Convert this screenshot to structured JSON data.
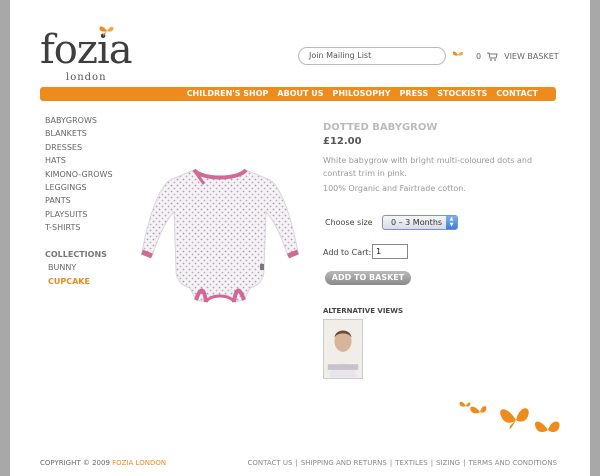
{
  "brand": {
    "name": "fozia",
    "sub": "london"
  },
  "header": {
    "mailing_label": "Join Mailing List",
    "basket_count": "0",
    "basket_label": "VIEW BASKET"
  },
  "nav": [
    "CHILDREN'S SHOP",
    "ABOUT US",
    "PHILOSOPHY",
    "PRESS",
    "STOCKISTS",
    "CONTACT"
  ],
  "sidebar": {
    "categories": [
      "BABYGROWS",
      "BLANKETS",
      "DRESSES",
      "HATS",
      "KIMONO-GROWS",
      "LEGGINGS",
      "PANTS",
      "PLAYSUITS",
      "T-SHIRTS"
    ],
    "collections_heading": "COLLECTIONS",
    "collections": [
      "BUNNY",
      "CUPCAKE"
    ]
  },
  "product": {
    "title": "DOTTED BABYGROW",
    "price": "£12.00",
    "description": "White babygrow with bright multi-coloured dots and contrast trim in pink.",
    "certification": "100% Organic and Fairtrade cotton.",
    "size_label": "Choose size",
    "size_value": "0 – 3 Months",
    "cart_label": "Add to Cart:",
    "cart_qty": "1",
    "add_button": "ADD TO BASKET",
    "alt_heading": "ALTERNATIVE VIEWS"
  },
  "footer": {
    "copyright_prefix": "COPYRIGHT © 2009",
    "copyright_brand": "FOZIA LONDON",
    "links": [
      "CONTACT US",
      "SHIPPING AND RETURNS",
      "TEXTILES",
      "SIZING",
      "TERMS AND CONDITIONS"
    ]
  },
  "colors": {
    "accent": "#ed8b1d",
    "background": "#a8a8a8",
    "trim": "#d26894"
  },
  "icons": [
    "butterfly-icon",
    "basket-icon",
    "select-arrows-icon"
  ]
}
